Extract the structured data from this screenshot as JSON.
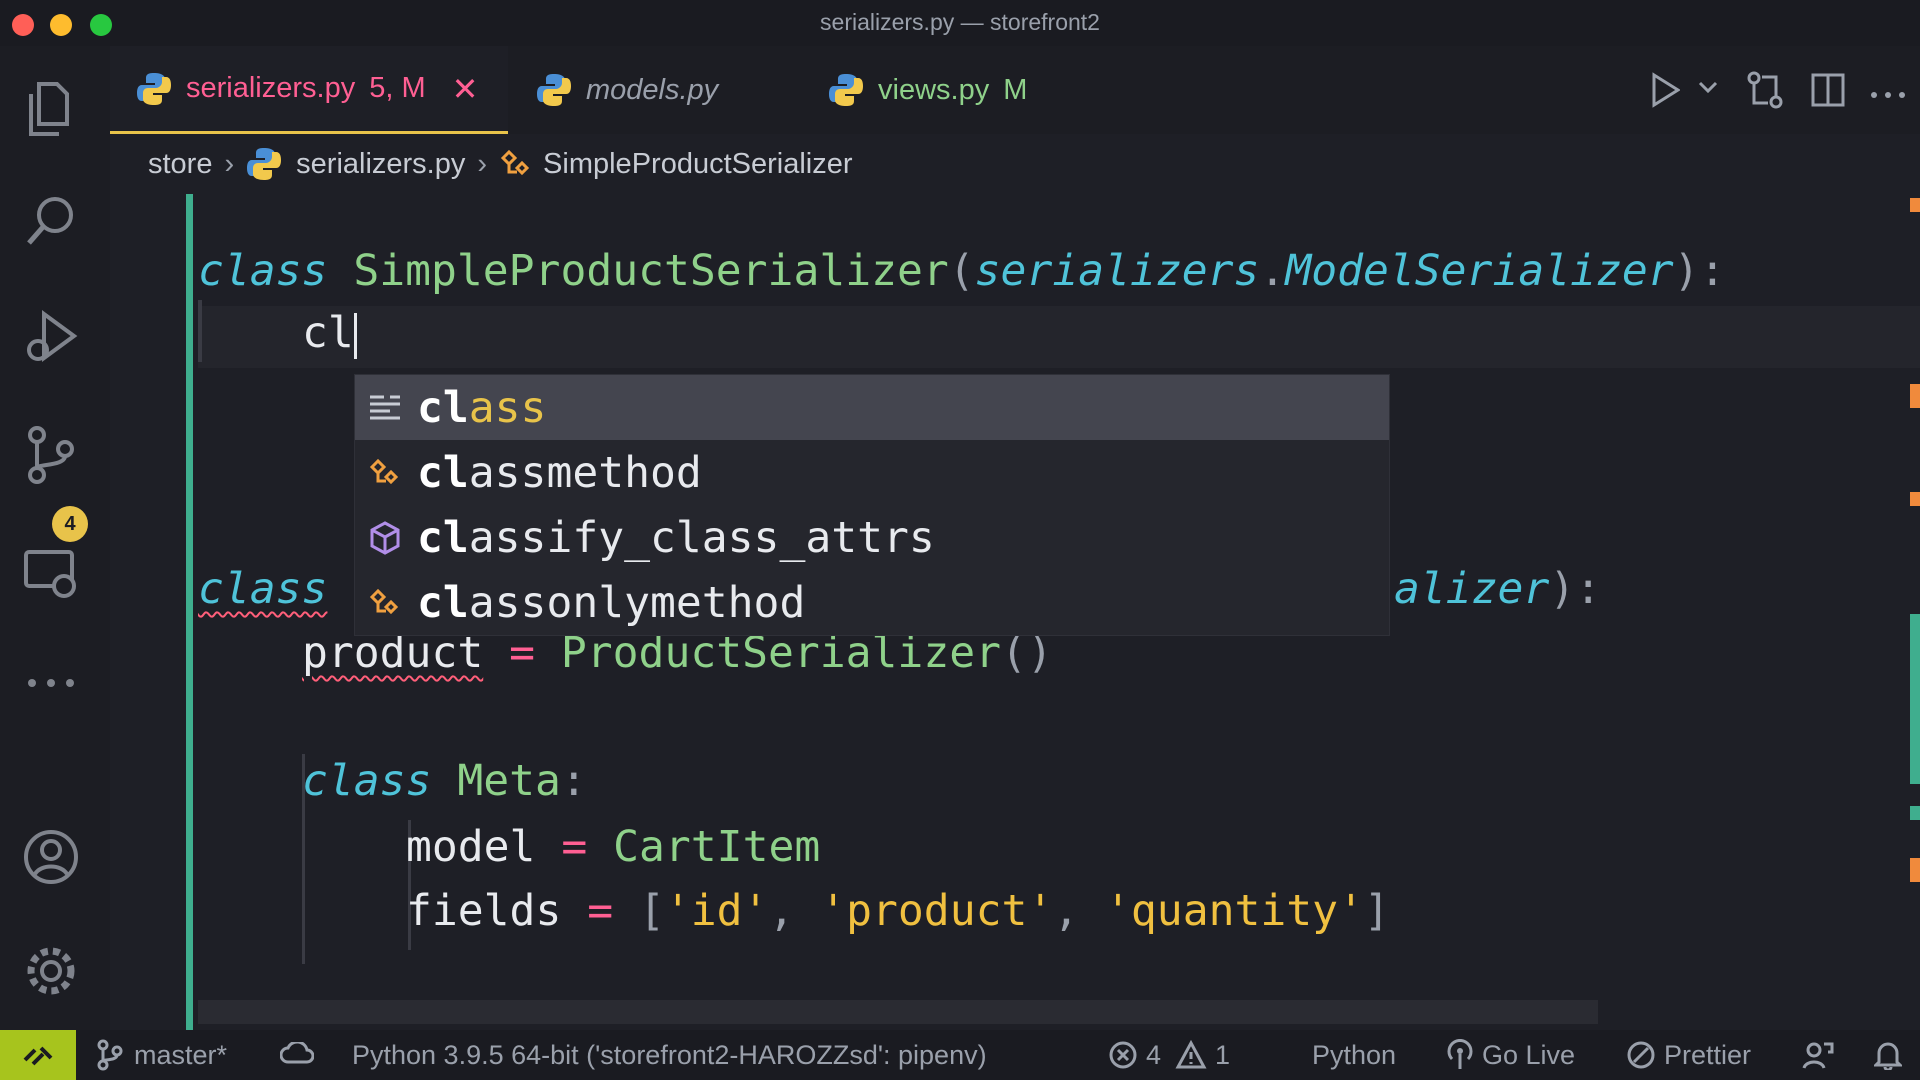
{
  "window": {
    "title": "serializers.py — storefront2"
  },
  "tabs": [
    {
      "name": "serializers.py",
      "badge": "5, M",
      "color": "#ff5f93"
    },
    {
      "name": "models.py",
      "badge": "",
      "color": "#9aa0ab"
    },
    {
      "name": "views.py",
      "badge": "M",
      "color": "#8fd18a"
    }
  ],
  "breadcrumb": {
    "folder": "store",
    "file": "serializers.py",
    "symbol": "SimpleProductSerializer"
  },
  "activity": {
    "source_control_badge": "4"
  },
  "code": {
    "l1": {
      "kw": "class",
      "name": "SimpleProductSerializer",
      "open": "(",
      "base1": "serializers",
      "dot": ".",
      "base2": "ModelSerializer",
      "close": "):"
    },
    "l2": {
      "text": "cl"
    },
    "l5": {
      "kw": "class",
      "tail": "alizer",
      "close": "):"
    },
    "l6": {
      "var": "product",
      "eq": "=",
      "call": "ProductSerializer",
      "parens": "()"
    },
    "l8": {
      "kw": "class",
      "name": "Meta",
      "colon": ":"
    },
    "l9": {
      "var": "model",
      "eq": "=",
      "val": "CartItem"
    },
    "l10": {
      "var": "fields",
      "eq": "=",
      "open": "[",
      "s1": "'id'",
      "c1": ",",
      "s2": "'product'",
      "c2": ",",
      "s3": "'quantity'",
      "close": "]"
    }
  },
  "suggestions": [
    {
      "match": "cl",
      "rest": "ass",
      "icon": "keyword-icon"
    },
    {
      "match": "cl",
      "rest": "assmethod",
      "icon": "class-icon"
    },
    {
      "match": "cl",
      "rest": "assify_class_attrs",
      "icon": "module-icon"
    },
    {
      "match": "cl",
      "rest": "assonlymethod",
      "icon": "class-icon"
    }
  ],
  "status": {
    "branch": "master*",
    "interpreter": "Python 3.9.5 64-bit ('storefront2-HAROZZsd': pipenv)",
    "errors": "4",
    "warnings": "1",
    "language": "Python",
    "golive": "Go Live",
    "prettier": "Prettier"
  }
}
